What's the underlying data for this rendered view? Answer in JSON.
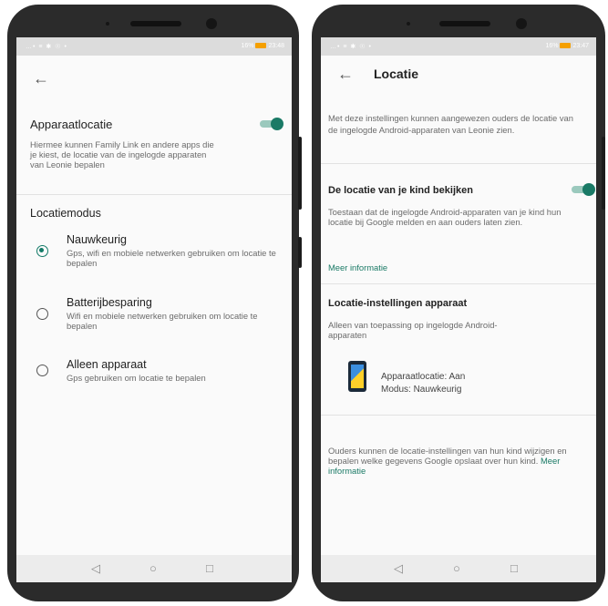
{
  "left_phone": {
    "status_left": "…• ≡ ✱ ☉ •",
    "status_right_percent": "16%",
    "status_time": "23:48",
    "back_icon": "arrow-left",
    "apparaatlocatie": {
      "title": "Apparaatlocatie",
      "description": "Hiermee kunnen Family Link en andere apps die je kiest, de locatie van de ingelogde apparaten van Leonie bepalen",
      "toggle_on": true
    },
    "section_title": "Locatiemodus",
    "options": [
      {
        "title": "Nauwkeurig",
        "desc": "Gps, wifi en mobiele netwerken gebruiken om locatie te bepalen",
        "selected": true
      },
      {
        "title": "Batterijbesparing",
        "desc": "Wifi en mobiele netwerken gebruiken om locatie te bepalen",
        "selected": false
      },
      {
        "title": "Alleen apparaat",
        "desc": "Gps gebruiken om locatie te bepalen",
        "selected": false
      }
    ]
  },
  "right_phone": {
    "status_left": "…• ≡ ✱ ☉ •",
    "status_right_percent": "16%",
    "status_time": "23:47",
    "back_icon": "arrow-left",
    "title": "Locatie",
    "intro": "Met deze instellingen kunnen aangewezen ouders de locatie van de ingelogde Android-apparaten van Leonie zien.",
    "kind_locatie": {
      "title": "De locatie van je kind bekijken",
      "description": "Toestaan dat de ingelogde Android-apparaten van je kind hun locatie bij Google melden en aan ouders laten zien.",
      "link": "Meer informatie",
      "toggle_on": true
    },
    "instellingen": {
      "title": "Locatie-instellingen apparaat",
      "description": "Alleen van toepassing op ingelogde Android-apparaten",
      "device_line1": "Apparaatlocatie: Aan",
      "device_line2": "Modus: Nauwkeurig"
    },
    "footer_text": "Ouders kunnen de locatie-instellingen van hun kind wijzigen en bepalen welke gegevens Google opslaat over hun kind.",
    "footer_link": "Meer informatie"
  },
  "navbar": {
    "back": "◁",
    "home": "○",
    "recents": "□"
  },
  "colors": {
    "accent": "#1a7a66",
    "phone_body": "#2b2b2b",
    "screen_bg": "#fafafa"
  }
}
